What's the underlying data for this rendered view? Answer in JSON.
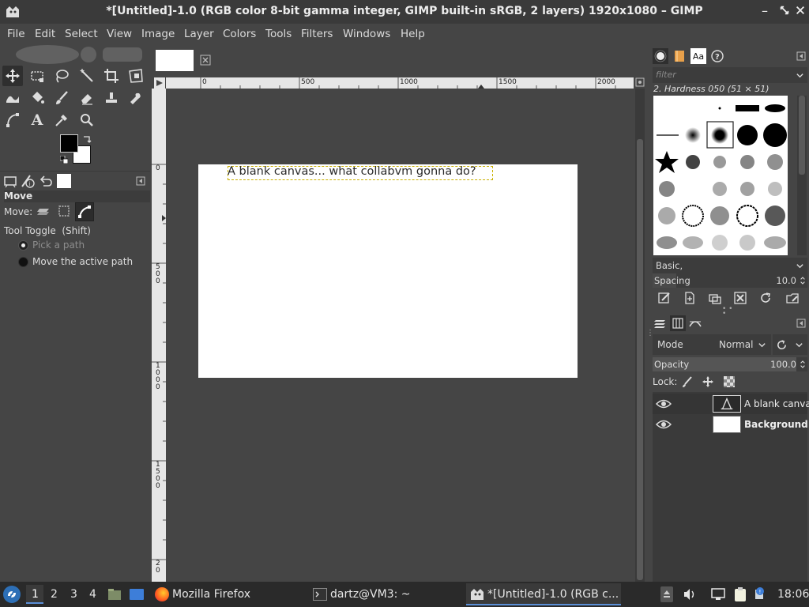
{
  "window": {
    "title": "*[Untitled]-1.0 (RGB color 8-bit gamma integer, GIMP built-in sRGB, 2 layers) 1920x1080 – GIMP"
  },
  "menu": [
    "File",
    "Edit",
    "Select",
    "View",
    "Image",
    "Layer",
    "Colors",
    "Tools",
    "Filters",
    "Windows",
    "Help"
  ],
  "tool_options": {
    "title": "Move",
    "move_label": "Move:",
    "toggle_label": "Tool Toggle  (Shift)",
    "option_pick": "Pick a path",
    "option_move": "Move the active path"
  },
  "rulers": {
    "h_ticks": [
      "0",
      "500",
      "1000",
      "1500",
      "2000"
    ],
    "v_ticks": [
      "0",
      "5\n0\n0",
      "1\n0\n0\n0",
      "1\n5\n0\n0",
      "2\n0"
    ]
  },
  "canvas": {
    "text_layer": "A blank canvas... what collabvm gonna do?"
  },
  "brushes": {
    "filter_placeholder": "filter",
    "selected_brush": "2. Hardness 050 (51 × 51)",
    "preset": "Basic,",
    "spacing_label": "Spacing",
    "spacing_value": "10.0"
  },
  "layers": {
    "mode_label": "Mode",
    "mode_value": "Normal",
    "opacity_label": "Opacity",
    "opacity_value": "100.0",
    "lock_label": "Lock:",
    "items": [
      {
        "name": "A blank canva"
      },
      {
        "name": "Background"
      }
    ]
  },
  "taskbar": {
    "workspaces": [
      "1",
      "2",
      "3",
      "4"
    ],
    "apps": [
      "Mozilla Firefox",
      "dartz@VM3: ~",
      "*[Untitled]-1.0 (RGB c..."
    ],
    "clock": "18:06"
  }
}
